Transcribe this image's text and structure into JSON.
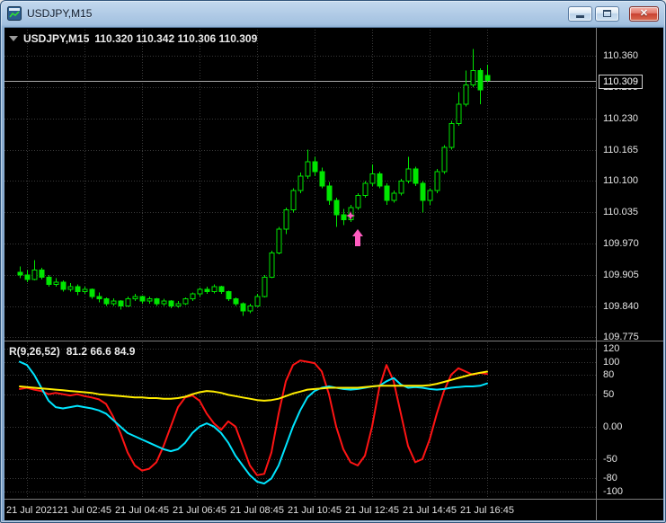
{
  "window": {
    "title": "USDJPY,M15",
    "controls": {
      "close_glyph": "✕"
    }
  },
  "chart": {
    "header": {
      "symbol": "USDJPY,M15",
      "ohlc": "110.320 110.342 110.306 110.309"
    },
    "price_axis_labels": [
      "110.360",
      "110.295",
      "110.230",
      "110.165",
      "110.100",
      "110.035",
      "109.970",
      "109.905",
      "109.840",
      "109.775"
    ],
    "current_price_label": "110.309"
  },
  "indicator": {
    "name": "R(9,26,52)",
    "values": "81.2 66.6 84.9",
    "axis_labels": [
      "120",
      "100",
      "80",
      "50",
      "0.00",
      "-50",
      "-80",
      "-100"
    ]
  },
  "time_axis": {
    "labels": [
      "21 Jul 2021",
      "21 Jul 02:45",
      "21 Jul 04:45",
      "21 Jul 06:45",
      "21 Jul 08:45",
      "21 Jul 10:45",
      "21 Jul 12:45",
      "21 Jul 14:45",
      "21 Jul 16:45"
    ]
  },
  "colors": {
    "candle": "#00e600",
    "grid": "#3a3a3a",
    "bid_line": "#a8a8a8",
    "axis_text": "#e6e6e6",
    "annotation": "#ff5bbf"
  },
  "chart_data": {
    "type": "candlestick",
    "symbol": "USDJPY",
    "timeframe": "M15",
    "title": "USDJPY,M15",
    "x_labels": [
      "21 Jul 2021",
      "21 Jul 02:45",
      "21 Jul 04:45",
      "21 Jul 06:45",
      "21 Jul 08:45",
      "21 Jul 10:45",
      "21 Jul 12:45",
      "21 Jul 14:45",
      "21 Jul 16:45"
    ],
    "price_range": [
      109.77,
      110.415
    ],
    "current_price": 110.309,
    "last_candle_ohlc": {
      "open": 110.32,
      "high": 110.342,
      "low": 110.306,
      "close": 110.309
    },
    "candles": [
      [
        109.91,
        109.922,
        109.898,
        109.905
      ],
      [
        109.905,
        109.915,
        109.89,
        109.895
      ],
      [
        109.895,
        109.935,
        109.893,
        109.915
      ],
      [
        109.915,
        109.92,
        109.895,
        109.9
      ],
      [
        109.9,
        109.905,
        109.88,
        109.885
      ],
      [
        109.885,
        109.898,
        109.88,
        109.89
      ],
      [
        109.89,
        109.893,
        109.87,
        109.875
      ],
      [
        109.875,
        109.888,
        109.87,
        109.88
      ],
      [
        109.88,
        109.885,
        109.863,
        109.87
      ],
      [
        109.87,
        109.88,
        109.865,
        109.875
      ],
      [
        109.875,
        109.877,
        109.855,
        109.86
      ],
      [
        109.86,
        109.868,
        109.848,
        109.855
      ],
      [
        109.855,
        109.858,
        109.84,
        109.845
      ],
      [
        109.845,
        109.856,
        109.84,
        109.85
      ],
      [
        109.85,
        109.852,
        109.833,
        109.84
      ],
      [
        109.84,
        109.86,
        109.838,
        109.855
      ],
      [
        109.855,
        109.865,
        109.85,
        109.86
      ],
      [
        109.86,
        109.862,
        109.845,
        109.85
      ],
      [
        109.85,
        109.86,
        109.845,
        109.855
      ],
      [
        109.855,
        109.857,
        109.84,
        109.845
      ],
      [
        109.845,
        109.855,
        109.84,
        109.85
      ],
      [
        109.85,
        109.852,
        109.835,
        109.84
      ],
      [
        109.84,
        109.85,
        109.836,
        109.845
      ],
      [
        109.845,
        109.858,
        109.842,
        109.855
      ],
      [
        109.855,
        109.868,
        109.85,
        109.865
      ],
      [
        109.865,
        109.878,
        109.86,
        109.875
      ],
      [
        109.875,
        109.88,
        109.865,
        109.87
      ],
      [
        109.87,
        109.885,
        109.866,
        109.88
      ],
      [
        109.88,
        109.882,
        109.865,
        109.87
      ],
      [
        109.87,
        109.872,
        109.85,
        109.855
      ],
      [
        109.855,
        109.858,
        109.84,
        109.845
      ],
      [
        109.845,
        109.848,
        109.82,
        109.83
      ],
      [
        109.83,
        109.845,
        109.825,
        109.84
      ],
      [
        109.84,
        109.865,
        109.838,
        109.86
      ],
      [
        109.86,
        109.905,
        109.858,
        109.9
      ],
      [
        109.9,
        109.955,
        109.898,
        109.95
      ],
      [
        109.95,
        110.005,
        109.948,
        110.0
      ],
      [
        110.0,
        110.045,
        109.99,
        110.04
      ],
      [
        110.04,
        110.085,
        110.035,
        110.08
      ],
      [
        110.08,
        110.118,
        110.075,
        110.11
      ],
      [
        110.11,
        110.165,
        110.105,
        110.14
      ],
      [
        110.14,
        110.15,
        110.11,
        110.12
      ],
      [
        110.12,
        110.128,
        110.085,
        110.09
      ],
      [
        110.09,
        110.098,
        110.05,
        110.06
      ],
      [
        110.06,
        110.065,
        110.005,
        110.03
      ],
      [
        110.03,
        110.042,
        110.008,
        110.02
      ],
      [
        110.02,
        110.05,
        110.015,
        110.045
      ],
      [
        110.045,
        110.075,
        110.04,
        110.07
      ],
      [
        110.07,
        110.1,
        110.065,
        110.095
      ],
      [
        110.095,
        110.135,
        110.09,
        110.115
      ],
      [
        110.115,
        110.12,
        110.085,
        110.09
      ],
      [
        110.09,
        110.095,
        110.05,
        110.06
      ],
      [
        110.06,
        110.08,
        110.055,
        110.075
      ],
      [
        110.075,
        110.105,
        110.07,
        110.1
      ],
      [
        110.1,
        110.15,
        110.095,
        110.125
      ],
      [
        110.125,
        110.13,
        110.09,
        110.095
      ],
      [
        110.095,
        110.1,
        110.035,
        110.06
      ],
      [
        110.06,
        110.085,
        110.05,
        110.08
      ],
      [
        110.08,
        110.125,
        110.075,
        110.12
      ],
      [
        110.12,
        110.175,
        110.115,
        110.17
      ],
      [
        110.17,
        110.225,
        110.165,
        110.22
      ],
      [
        110.22,
        110.285,
        110.215,
        110.26
      ],
      [
        110.26,
        110.33,
        110.255,
        110.3
      ],
      [
        110.3,
        110.375,
        110.295,
        110.33
      ],
      [
        110.33,
        110.335,
        110.26,
        110.29
      ],
      [
        110.32,
        110.342,
        110.306,
        110.309
      ]
    ],
    "oscillator": {
      "name": "R(9,26,52)",
      "range": [
        -110,
        130
      ],
      "levels": [
        120,
        100,
        80,
        50,
        0,
        -50,
        -80,
        -100
      ],
      "last_values": [
        81.2,
        66.6,
        84.9
      ],
      "series": [
        {
          "name": "R9",
          "color": "#ff1414",
          "values": [
            58,
            60,
            57,
            55,
            50,
            52,
            50,
            48,
            50,
            47,
            45,
            42,
            35,
            15,
            -10,
            -40,
            -60,
            -68,
            -65,
            -55,
            -30,
            0,
            30,
            45,
            48,
            40,
            20,
            5,
            -5,
            8,
            0,
            -30,
            -60,
            -75,
            -73,
            -40,
            20,
            70,
            95,
            102,
            100,
            98,
            85,
            50,
            0,
            -35,
            -55,
            -60,
            -45,
            0,
            60,
            95,
            70,
            20,
            -30,
            -55,
            -50,
            -20,
            20,
            55,
            80,
            90,
            85,
            80,
            83,
            81.2
          ]
        },
        {
          "name": "R26",
          "color": "#00e5ff",
          "values": [
            100,
            95,
            80,
            60,
            40,
            30,
            28,
            30,
            32,
            30,
            28,
            25,
            20,
            10,
            0,
            -10,
            -15,
            -20,
            -25,
            -30,
            -35,
            -38,
            -35,
            -25,
            -10,
            0,
            5,
            0,
            -10,
            -25,
            -45,
            -60,
            -75,
            -85,
            -88,
            -80,
            -60,
            -30,
            0,
            25,
            45,
            55,
            60,
            62,
            60,
            58,
            57,
            58,
            60,
            62,
            63,
            70,
            75,
            65,
            60,
            61,
            60,
            58,
            57,
            58,
            60,
            61,
            62,
            62,
            63,
            66.6
          ]
        },
        {
          "name": "R52",
          "color": "#ffec00",
          "values": [
            62,
            61,
            60,
            59,
            58,
            57,
            56,
            55,
            54,
            53,
            52,
            50,
            49,
            48,
            47,
            46,
            45,
            45,
            44,
            44,
            43,
            43,
            44,
            46,
            50,
            53,
            55,
            54,
            52,
            49,
            47,
            45,
            43,
            41,
            40,
            41,
            43,
            47,
            51,
            54,
            57,
            58,
            59,
            60,
            60,
            60,
            60,
            60,
            61,
            62,
            63,
            63,
            63,
            63,
            63,
            63,
            63,
            64,
            66,
            69,
            72,
            75,
            78,
            81,
            83,
            84.9
          ]
        }
      ]
    },
    "annotations": [
      {
        "type": "up-arrow",
        "index": 47,
        "price": 110.0,
        "color": "#ff5bbf"
      },
      {
        "type": "star",
        "index": 46,
        "price": 110.028,
        "color": "#ff5bbf"
      }
    ]
  }
}
